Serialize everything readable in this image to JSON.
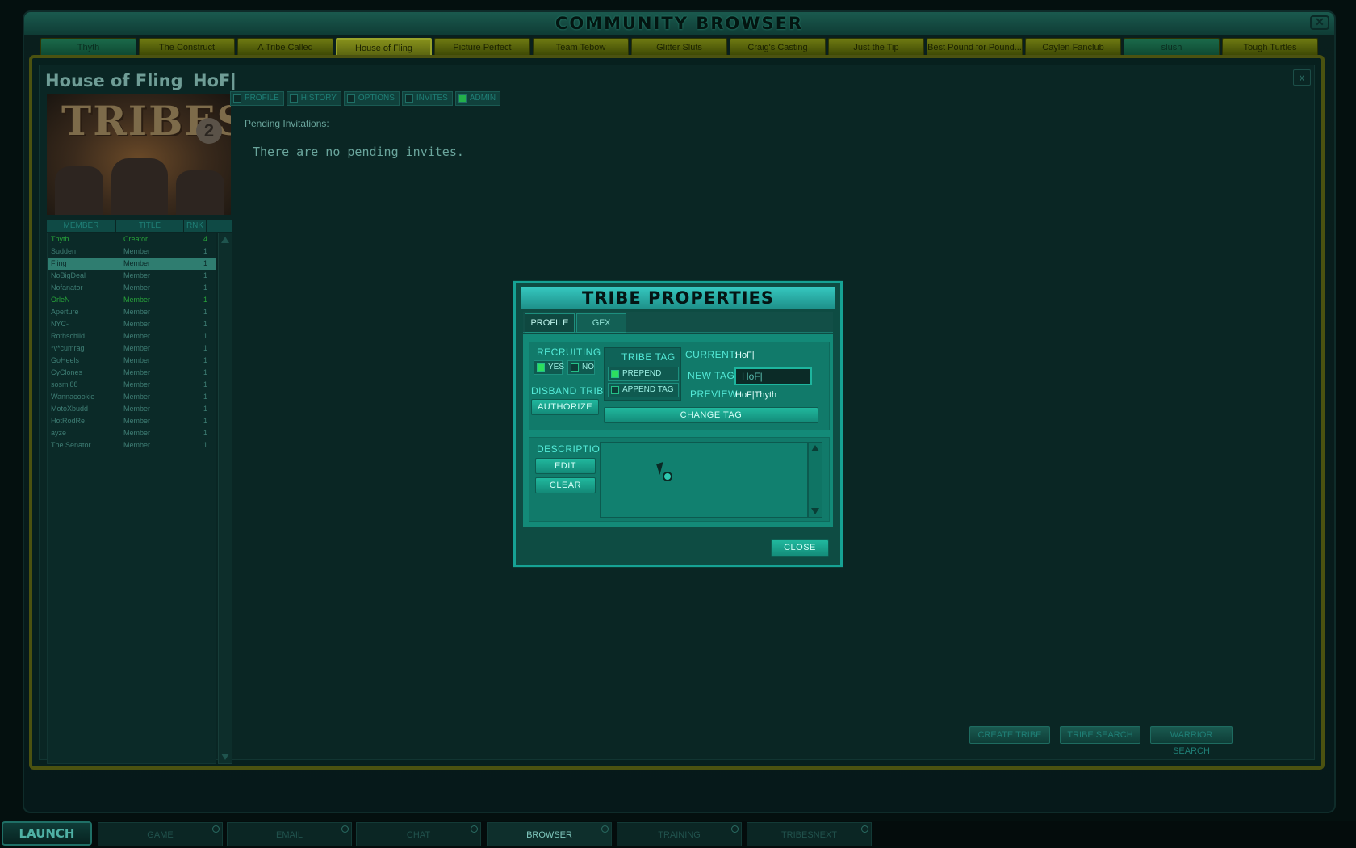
{
  "window": {
    "title": "COMMUNITY BROWSER",
    "close_icon": "close-icon"
  },
  "tabs": [
    {
      "label": "Thyth",
      "style": "green"
    },
    {
      "label": "The Construct",
      "style": "olive"
    },
    {
      "label": "A Tribe Called",
      "style": "olive"
    },
    {
      "label": "House of Fling",
      "style": "active"
    },
    {
      "label": "Picture Perfect",
      "style": "olive"
    },
    {
      "label": "Team Tebow",
      "style": "olive"
    },
    {
      "label": "Glitter Sluts",
      "style": "olive"
    },
    {
      "label": "Craig's Casting",
      "style": "olive"
    },
    {
      "label": "Just the Tip",
      "style": "olive"
    },
    {
      "label": "Best Pound for Pound...",
      "style": "olive"
    },
    {
      "label": "Caylen Fanclub",
      "style": "olive"
    },
    {
      "label": "slush",
      "style": "green"
    },
    {
      "label": "Tough Turtles",
      "style": "olive"
    }
  ],
  "tribe": {
    "name": "House of Fling",
    "tag": "HoF|",
    "close_label": "x",
    "logo_text": "TRIBES",
    "logo_number": "2",
    "subtabs": [
      "PROFILE",
      "HISTORY",
      "OPTIONS",
      "INVITES",
      "ADMIN"
    ],
    "roster_headers": [
      "MEMBER",
      "TITLE",
      "RNK"
    ],
    "roster": [
      {
        "name": "Thyth",
        "title": "Creator",
        "rank": "4",
        "style": "green"
      },
      {
        "name": "Sudden",
        "title": "Member",
        "rank": "1",
        "style": ""
      },
      {
        "name": "Fling",
        "title": "Member",
        "rank": "1",
        "style": "hl"
      },
      {
        "name": "NoBigDeal",
        "title": "Member",
        "rank": "1",
        "style": ""
      },
      {
        "name": "Nofanator",
        "title": "Member",
        "rank": "1",
        "style": ""
      },
      {
        "name": "OrleN",
        "title": "Member",
        "rank": "1",
        "style": "green"
      },
      {
        "name": "Aperture",
        "title": "Member",
        "rank": "1",
        "style": ""
      },
      {
        "name": "NYC-",
        "title": "Member",
        "rank": "1",
        "style": ""
      },
      {
        "name": "Rothschild",
        "title": "Member",
        "rank": "1",
        "style": ""
      },
      {
        "name": "*v*cumrag",
        "title": "Member",
        "rank": "1",
        "style": ""
      },
      {
        "name": "GoHeels",
        "title": "Member",
        "rank": "1",
        "style": ""
      },
      {
        "name": "CyClones",
        "title": "Member",
        "rank": "1",
        "style": ""
      },
      {
        "name": "sosmi88",
        "title": "Member",
        "rank": "1",
        "style": ""
      },
      {
        "name": "Wannacookie",
        "title": "Member",
        "rank": "1",
        "style": ""
      },
      {
        "name": "MotoXbudd",
        "title": "Member",
        "rank": "1",
        "style": ""
      },
      {
        "name": "HotRodRe",
        "title": "Member",
        "rank": "1",
        "style": ""
      },
      {
        "name": "ayze",
        "title": "Member",
        "rank": "1",
        "style": ""
      },
      {
        "name": "The Senator",
        "title": "Member",
        "rank": "1",
        "style": ""
      }
    ],
    "pending_label": "Pending Invitations:",
    "no_invites": "There are no pending invites.",
    "buttons": {
      "create": "CREATE TRIBE",
      "search": "TRIBE SEARCH",
      "warrior": "WARRIOR SEARCH"
    }
  },
  "dialog": {
    "title": "TRIBE PROPERTIES",
    "tabs": [
      "PROFILE",
      "GFX"
    ],
    "recruiting_label": "RECRUITING",
    "yes_label": "YES",
    "no_label": "NO",
    "disband_label": "DISBAND TRIBE",
    "authorize_label": "AUTHORIZE",
    "tribe_tag_label": "TRIBE TAG",
    "prepend_label": "PREPEND TAG",
    "append_label": "APPEND TAG",
    "current_label": "CURRENT:",
    "current_value": "HoF|",
    "new_tag_label": "NEW TAG:",
    "new_tag_value": "HoF|",
    "preview_label": "PREVIEW:",
    "preview_value": "HoF|Thyth",
    "change_tag_label": "CHANGE TAG",
    "description_label": "DESCRIPTION",
    "edit_label": "EDIT",
    "clear_label": "CLEAR",
    "description_text": "",
    "close_label": "CLOSE"
  },
  "taskbar": {
    "launch": "LAUNCH",
    "items": [
      "GAME",
      "EMAIL",
      "CHAT",
      "BROWSER",
      "TRAINING",
      "TRIBESNEXT"
    ],
    "active": "BROWSER"
  }
}
